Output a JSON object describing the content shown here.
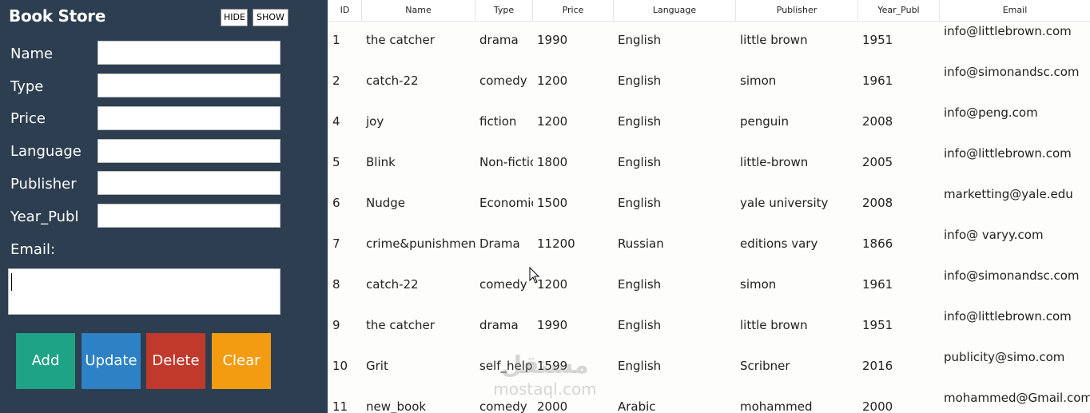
{
  "app": {
    "title": "Book Store",
    "hide_label": "HIDE",
    "show_label": "SHOW"
  },
  "form": {
    "name_label": "Name",
    "type_label": "Type",
    "price_label": "Price",
    "language_label": "Language",
    "publisher_label": "Publisher",
    "year_label": "Year_Publ",
    "email_label": "Email:",
    "name_value": "",
    "type_value": "",
    "price_value": "",
    "language_value": "",
    "publisher_value": "",
    "year_value": "",
    "email_value": ""
  },
  "actions": {
    "add": "Add",
    "update": "Update",
    "delete": "Delete",
    "clear": "Clear"
  },
  "table": {
    "headers": [
      "ID",
      "Name",
      "Type",
      "Price",
      "Language",
      "Publisher",
      "Year_Publ",
      "Email"
    ],
    "rows": [
      [
        "1",
        "the catcher",
        "drama",
        "1990",
        "English",
        "little brown",
        "1951",
        "info@littlebrown.com"
      ],
      [
        "2",
        "catch-22",
        "comedy",
        "1200",
        "English",
        "simon",
        "1961",
        "info@simonandsc.com"
      ],
      [
        "4",
        "joy",
        "fiction",
        "1200",
        "English",
        "penguin",
        "2008",
        "info@peng.com"
      ],
      [
        "5",
        "Blink",
        "Non-fiction",
        "1800",
        "English",
        "little-brown",
        "2005",
        "info@littlebrown.com"
      ],
      [
        "6",
        "Nudge",
        "Economics",
        "1500",
        "English",
        "yale university",
        "2008",
        "marketting@yale.edu"
      ],
      [
        "7",
        "crime&punishment",
        "Drama",
        "11200",
        "Russian",
        "editions vary",
        "1866",
        "info@ varyy.com"
      ],
      [
        "8",
        "catch-22",
        "comedy",
        "1200",
        "English",
        "simon",
        "1961",
        "info@simonandsc.com"
      ],
      [
        "9",
        "the catcher",
        "drama",
        "1990",
        "English",
        "little brown",
        "1951",
        "info@littlebrown.com"
      ],
      [
        "10",
        "Grit",
        "self_help",
        "1599",
        "English",
        "Scribner",
        "2016",
        "publicity@simo.com"
      ],
      [
        "11",
        "new_book",
        "comedy",
        "2000",
        "Arabic",
        "mohammed",
        "2000",
        "mohammed@Gmail.com"
      ]
    ]
  },
  "watermark": {
    "arabic": "مستقل",
    "latin": "mostaql.com"
  },
  "colors": {
    "sidebar": "#2c3e50",
    "add": "#1fa387",
    "update": "#2c82c4",
    "delete": "#c0392b",
    "clear": "#f39c12"
  }
}
